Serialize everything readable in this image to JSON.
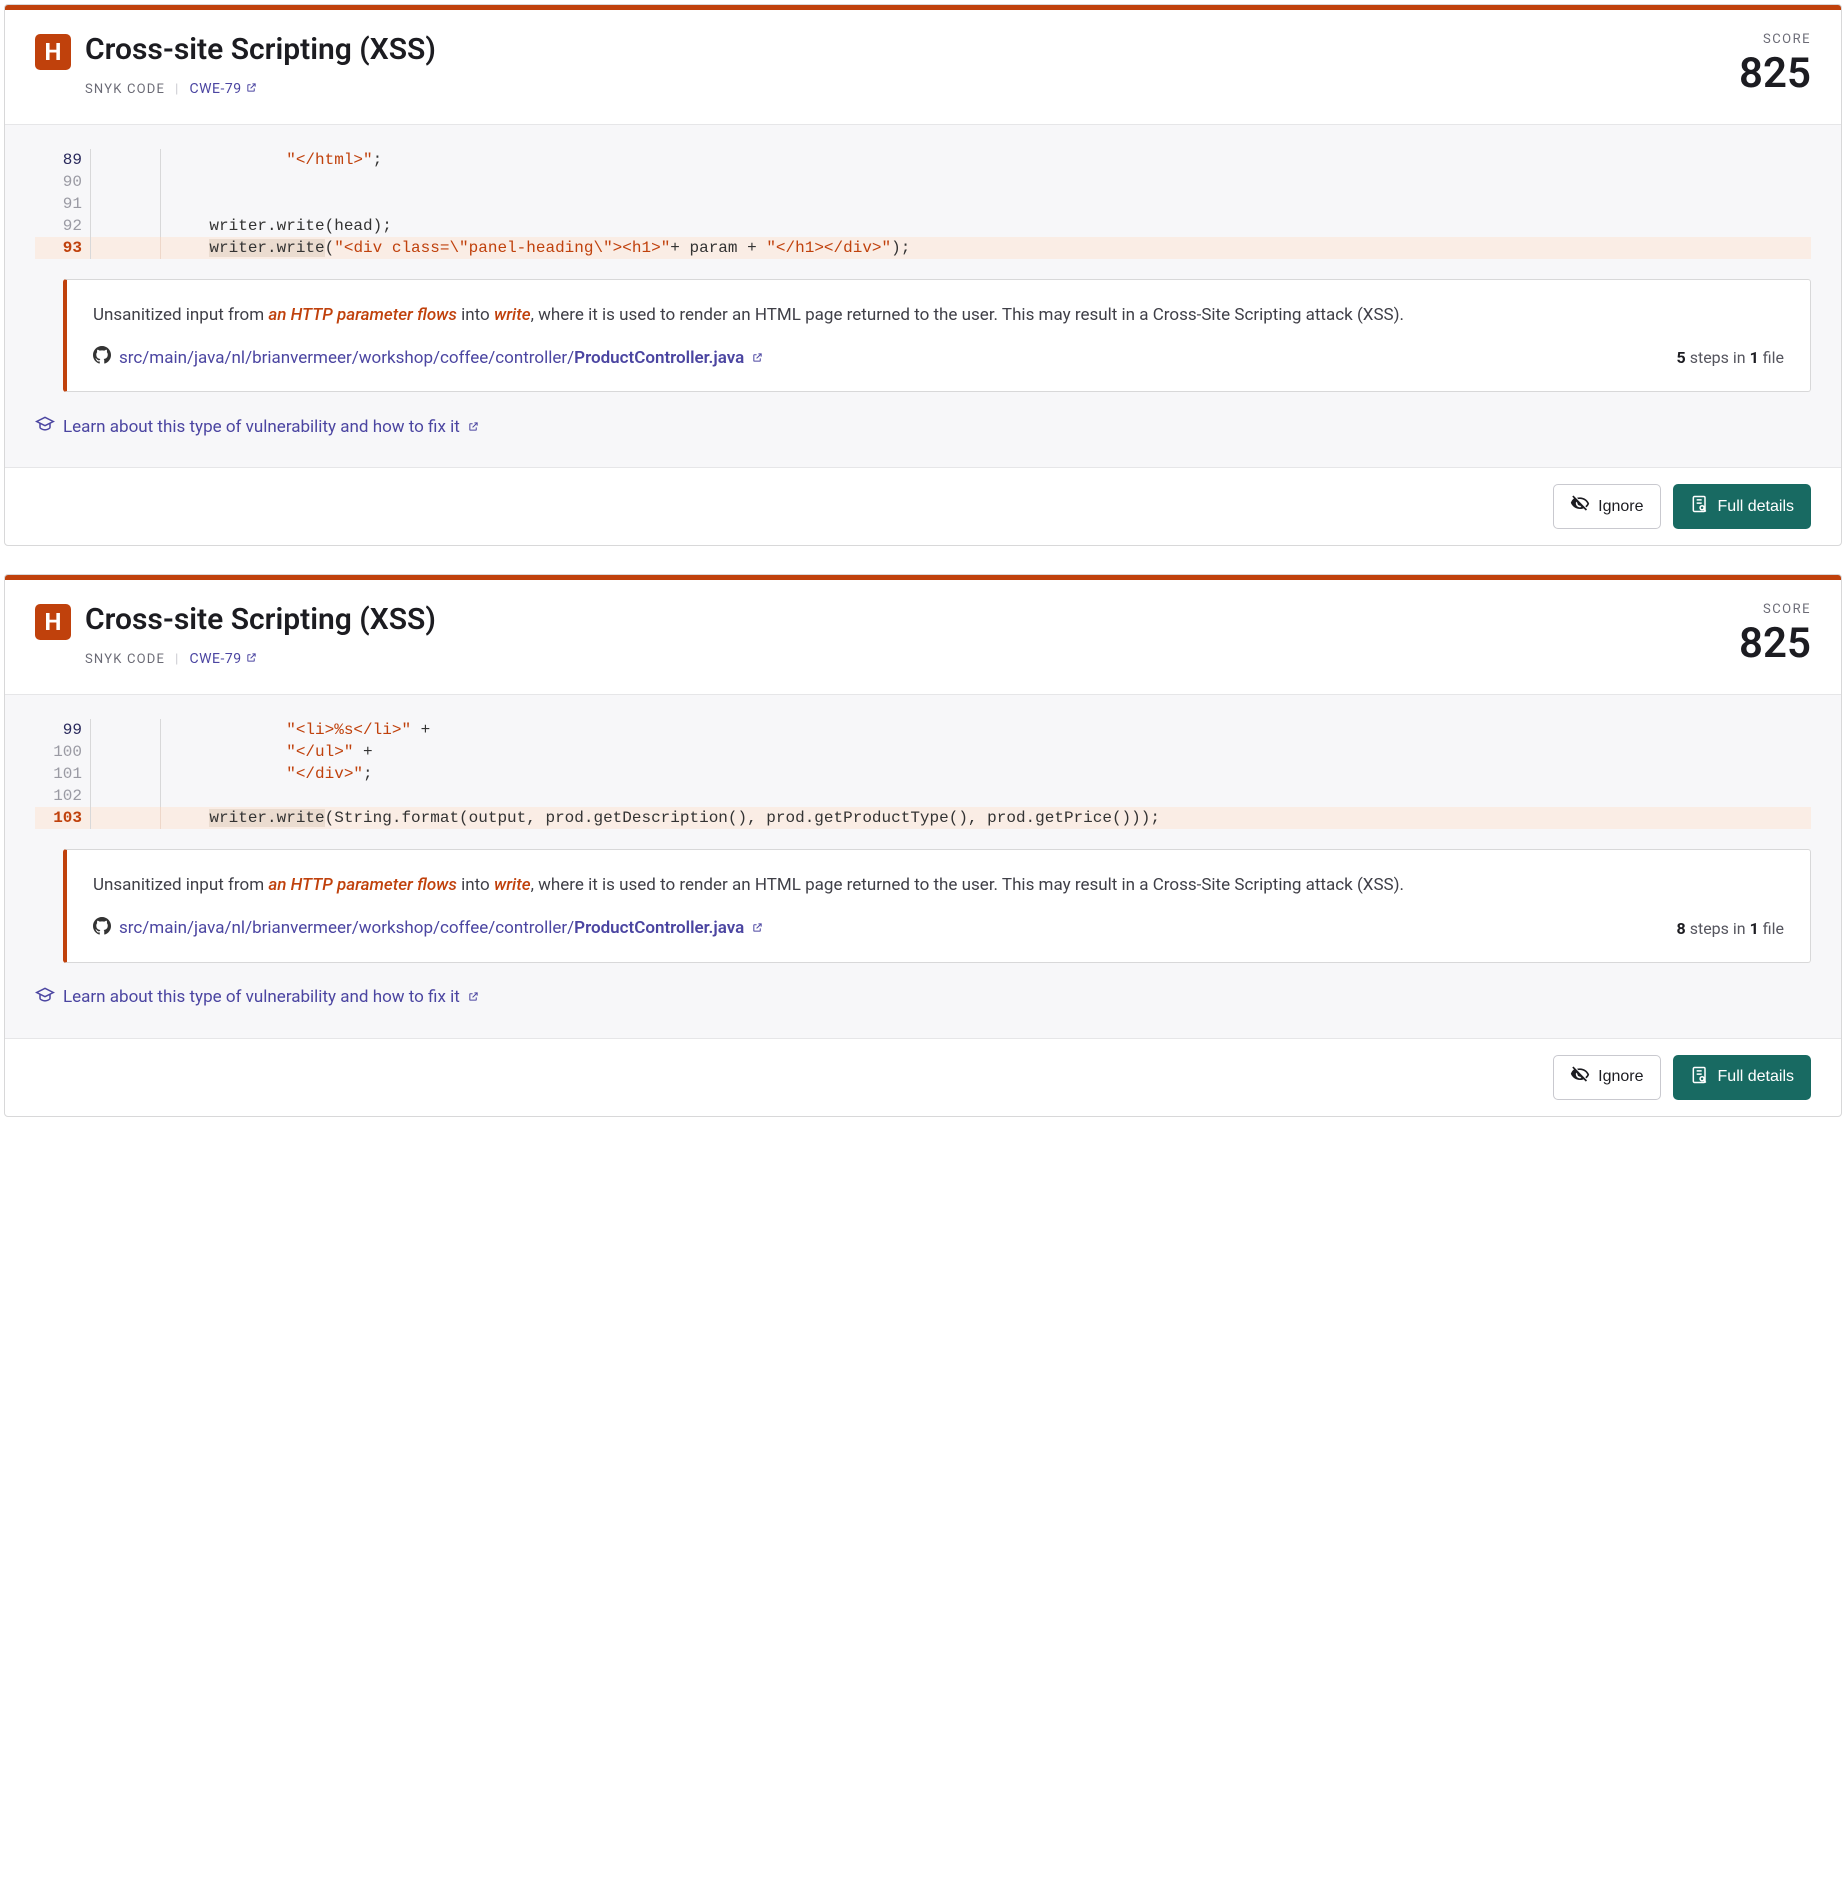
{
  "vulnerabilities": [
    {
      "severity_letter": "H",
      "title": "Cross-site Scripting (XSS)",
      "source": "SNYK CODE",
      "cwe": "CWE-79",
      "score_label": "SCORE",
      "score": "825",
      "code_lines": [
        {
          "n": "89",
          "cls": "cur",
          "segments": [
            {
              "t": "            ",
              "c": ""
            },
            {
              "t": "\"</html>\"",
              "c": "tok-str"
            },
            {
              "t": ";",
              "c": "tok-plain"
            }
          ]
        },
        {
          "n": "90",
          "cls": "",
          "segments": []
        },
        {
          "n": "91",
          "cls": "",
          "segments": []
        },
        {
          "n": "92",
          "cls": "",
          "segments": [
            {
              "t": "    writer.write(head);",
              "c": "tok-plain"
            }
          ]
        },
        {
          "n": "93",
          "cls": "hl",
          "segments": [
            {
              "t": "    ",
              "c": ""
            },
            {
              "t": "writer.write",
              "c": "tok-plain uline"
            },
            {
              "t": "(",
              "c": "tok-plain"
            },
            {
              "t": "\"<div class=\\\"panel-heading\\\"><h1>\"",
              "c": "tok-str"
            },
            {
              "t": "+ param + ",
              "c": "tok-plain"
            },
            {
              "t": "\"</h1></div>\"",
              "c": "tok-str"
            },
            {
              "t": ");",
              "c": "tok-plain"
            }
          ]
        }
      ],
      "desc_pre": "Unsanitized input from ",
      "desc_em1": "an HTTP parameter flows",
      "desc_mid": " into ",
      "desc_em2": "write",
      "desc_post": ", where it is used to render an HTML page returned to the user. This may result in a Cross-Site Scripting attack (XSS).",
      "file_path": "src/main/java/nl/brianvermeer/workshop/coffee/controller/",
      "file_name": "ProductController.java",
      "steps_n": "5",
      "steps_mid": " steps in ",
      "files_n": "1",
      "files_suffix": " file",
      "learn_text": "Learn about this type of vulnerability and how to fix it",
      "ignore_label": "Ignore",
      "details_label": "Full details"
    },
    {
      "severity_letter": "H",
      "title": "Cross-site Scripting (XSS)",
      "source": "SNYK CODE",
      "cwe": "CWE-79",
      "score_label": "SCORE",
      "score": "825",
      "code_lines": [
        {
          "n": "99",
          "cls": "cur",
          "segments": [
            {
              "t": "            ",
              "c": ""
            },
            {
              "t": "\"<li>%s</li>\"",
              "c": "tok-str"
            },
            {
              "t": " +",
              "c": "tok-plain"
            }
          ]
        },
        {
          "n": "100",
          "cls": "",
          "segments": [
            {
              "t": "            ",
              "c": ""
            },
            {
              "t": "\"</ul>\"",
              "c": "tok-str"
            },
            {
              "t": " +",
              "c": "tok-plain"
            }
          ]
        },
        {
          "n": "101",
          "cls": "",
          "segments": [
            {
              "t": "            ",
              "c": ""
            },
            {
              "t": "\"</div>\"",
              "c": "tok-str"
            },
            {
              "t": ";",
              "c": "tok-plain"
            }
          ]
        },
        {
          "n": "102",
          "cls": "",
          "segments": []
        },
        {
          "n": "103",
          "cls": "hl",
          "segments": [
            {
              "t": "    ",
              "c": ""
            },
            {
              "t": "writer.write",
              "c": "tok-plain uline"
            },
            {
              "t": "(String.format(output, prod.getDescription(), prod.getProductType(), prod.getPrice()));",
              "c": "tok-plain"
            }
          ]
        }
      ],
      "desc_pre": "Unsanitized input from ",
      "desc_em1": "an HTTP parameter flows",
      "desc_mid": " into ",
      "desc_em2": "write",
      "desc_post": ", where it is used to render an HTML page returned to the user. This may result in a Cross-Site Scripting attack (XSS).",
      "file_path": "src/main/java/nl/brianvermeer/workshop/coffee/controller/",
      "file_name": "ProductController.java",
      "steps_n": "8",
      "steps_mid": " steps in ",
      "files_n": "1",
      "files_suffix": " file",
      "learn_text": "Learn about this type of vulnerability and how to fix it",
      "ignore_label": "Ignore",
      "details_label": "Full details"
    }
  ]
}
